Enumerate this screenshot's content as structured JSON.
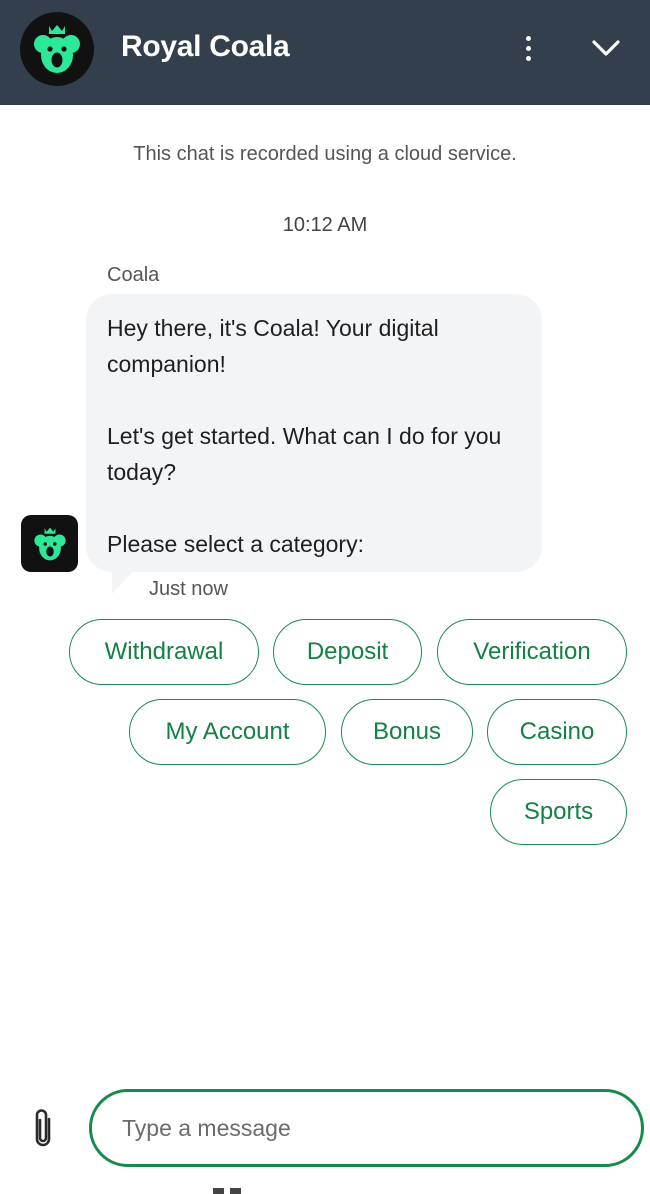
{
  "header": {
    "title": "Royal Coala",
    "logo_icon": "koala-logo-icon",
    "menu_icon": "vertical-dots-icon",
    "collapse_icon": "chevron-down-icon",
    "background": "#333f4c",
    "logo_color": "#2ee89a"
  },
  "chat": {
    "notice": "This chat is recorded using a cloud service.",
    "timestamp": "10:12 AM",
    "sender": "Coala",
    "message": {
      "line1": "Hey there, it's Coala! Your digital companion!",
      "line2": "Let's get started. What can I do for you today?",
      "line3": "Please select a category:"
    },
    "message_time": "Just now",
    "bubble_color": "#f3f4f6"
  },
  "categories": [
    "Withdrawal",
    "Deposit",
    "Verification",
    "My Account",
    "Bonus",
    "Casino",
    "Sports"
  ],
  "accent_color": "#168a4a",
  "composer": {
    "placeholder": "Type a message",
    "value": "",
    "attach_icon": "paperclip-icon"
  }
}
